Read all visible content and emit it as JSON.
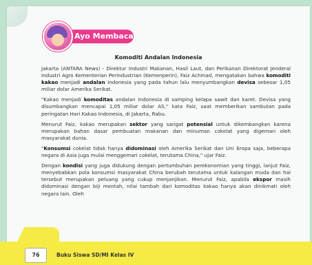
{
  "section": {
    "badge_label": "Ayo Membaca",
    "title": "Komoditi Andalan Indonesia"
  },
  "paragraphs": [
    {
      "segments": [
        {
          "text": "Jakarta (ANTARA News) - Direktur Industri Makanan, Hasil Laut, dan Perikanan Direktorat Jenderal Industri Agro Kementerian Perindustrian (Kemenperin), Faiz Achmad, mengatakan bahwa ",
          "bold": false
        },
        {
          "text": "komoditi kakao",
          "bold": true
        },
        {
          "text": " menjadi ",
          "bold": false
        },
        {
          "text": "andalan",
          "bold": true
        },
        {
          "text": " Indonesia yang pada tahun lalu menyumbangkan ",
          "bold": false
        },
        {
          "text": "devisa",
          "bold": true
        },
        {
          "text": " sebesar 1,05 miliar dolar Amerika Serikat.",
          "bold": false
        }
      ]
    },
    {
      "segments": [
        {
          "text": "\"Kakao menjadi ",
          "bold": false
        },
        {
          "text": "komoditas",
          "bold": true
        },
        {
          "text": " andalan Indonesia di samping kelapa sawit dan karet. Devisa yang disumbangkan mencapai 1,05 miliar dolar AS,\" kata Faiz, saat memberikan sambutan pada peringatan Hari Kakao Indonesia, di Jakarta, Rabu.",
          "bold": false
        }
      ]
    },
    {
      "segments": [
        {
          "text": "Menurut Faiz, kakao merupakan ",
          "bold": false
        },
        {
          "text": "sektor",
          "bold": true
        },
        {
          "text": " yang sangat ",
          "bold": false
        },
        {
          "text": "potensial",
          "bold": true
        },
        {
          "text": " untuk dikembangkan karena merupakan bahan dasar pembuatan makanan dan minuman cokelat yang digemari oleh masyarakat dunia.",
          "bold": false
        }
      ]
    },
    {
      "segments": [
        {
          "text": "\"",
          "bold": false
        },
        {
          "text": "Konsumsi",
          "bold": true
        },
        {
          "text": " cokelat tidak hanya ",
          "bold": false
        },
        {
          "text": "didominasi",
          "bold": true
        },
        {
          "text": " oleh Amerika Serikat dan Uni Eropa saja, beberapa negara di Asia juga mulai menggemari cokelat, terutama China,\" ujar Faiz.",
          "bold": false
        }
      ]
    },
    {
      "segments": [
        {
          "text": "Dengan ",
          "bold": false
        },
        {
          "text": "kondisi",
          "bold": true
        },
        {
          "text": " yang juga didukung dengan pertumbuhan perekonomian yang tinggi, lanjut Faiz, menyebabkan pola konsumsi masyarakat China berubah terutama untuk kalangan muda dan hal tersebut merupakan peluang yang cukup menjanjikan. Menurut Faiz, apabila ",
          "bold": false
        },
        {
          "text": "ekspor",
          "bold": true
        },
        {
          "text": " masih didominasi dengan biji mentah, nilai tambah dari komoditas kakao hanya akan dinikmati oleh negara lain. Oleh",
          "bold": false
        }
      ]
    }
  ],
  "footer": {
    "page_number": "76",
    "book_label": "Buku Siswa SD/MI Kelas IV"
  }
}
